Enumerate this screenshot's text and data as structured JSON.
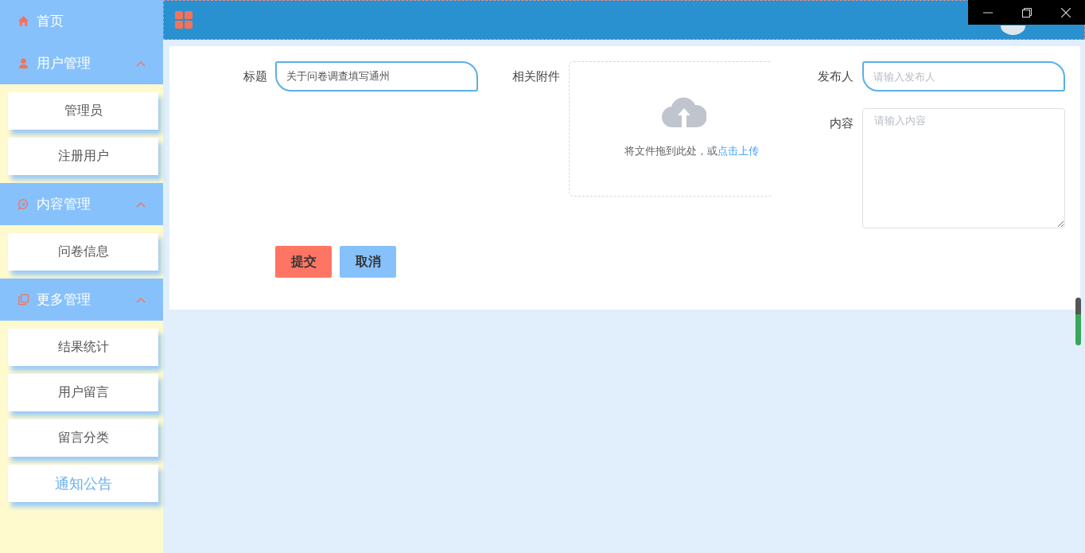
{
  "sidebar": {
    "home": {
      "label": "首页"
    },
    "groups": [
      {
        "label": "用户管理",
        "kind": "user",
        "expanded": true,
        "items": [
          {
            "label": "管理员",
            "selected": false
          },
          {
            "label": "注册用户",
            "selected": false
          }
        ]
      },
      {
        "label": "内容管理",
        "kind": "chat",
        "expanded": true,
        "items": [
          {
            "label": "问卷信息",
            "selected": false
          }
        ]
      },
      {
        "label": "更多管理",
        "kind": "copy",
        "expanded": true,
        "items": [
          {
            "label": "结果统计",
            "selected": false
          },
          {
            "label": "用户留言",
            "selected": false
          },
          {
            "label": "留言分类",
            "selected": false
          },
          {
            "label": "通知公告",
            "selected": true
          }
        ]
      }
    ]
  },
  "form": {
    "title": {
      "label": "标题",
      "value": "关于问卷调查填写通州"
    },
    "attachment": {
      "label": "相关附件",
      "hint": "将文件拖到此处，或",
      "link": "点击上传"
    },
    "publisher": {
      "label": "发布人",
      "placeholder": "请输入发布人"
    },
    "content": {
      "label": "内容",
      "placeholder": "请输入内容"
    }
  },
  "buttons": [
    {
      "label": "提交",
      "kind": "primary"
    },
    {
      "label": "取消",
      "kind": "secondary"
    }
  ]
}
